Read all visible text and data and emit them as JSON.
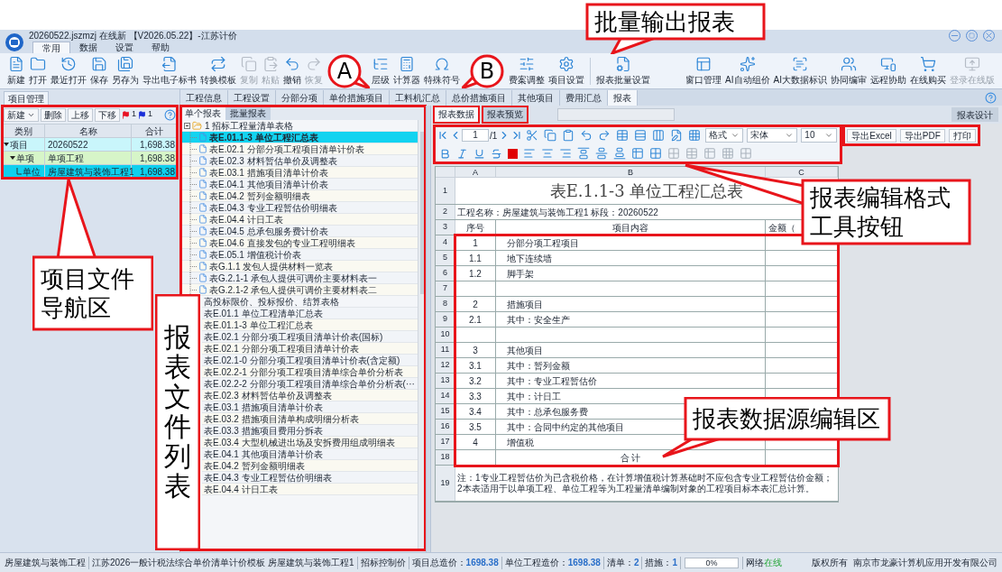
{
  "window": {
    "title": "20260522.jszmzj 在线新 【V2026.05.22】-江苏计价"
  },
  "ribbon_tabs": [
    {
      "label": "常用",
      "selected": true
    },
    {
      "label": "数据",
      "selected": false
    },
    {
      "label": "设置",
      "selected": false
    },
    {
      "label": "帮助",
      "selected": false
    }
  ],
  "toolbar": [
    {
      "label": "新建",
      "disabled": false
    },
    {
      "label": "打开",
      "disabled": false
    },
    {
      "label": "最近打开",
      "disabled": false
    },
    {
      "label": "保存",
      "disabled": false
    },
    {
      "label": "另存为",
      "disabled": false
    },
    {
      "label": "导出电子标书",
      "disabled": false
    },
    {
      "label": "转换模板",
      "disabled": false
    },
    {
      "label": "复制",
      "disabled": true
    },
    {
      "label": "粘贴",
      "disabled": true
    },
    {
      "label": "撤销",
      "disabled": false
    },
    {
      "label": "恢复",
      "disabled": true
    },
    {
      "label": "层级",
      "disabled": false
    },
    {
      "label": "计算器",
      "disabled": false
    },
    {
      "label": "特殊符号",
      "disabled": false
    },
    {
      "label": "费案调整",
      "disabled": false
    },
    {
      "label": "项目设置",
      "disabled": false
    },
    {
      "label": "报表批量设置",
      "disabled": false
    }
  ],
  "toolbar_right": [
    {
      "label": "窗口管理",
      "disabled": false
    },
    {
      "label": "AI自动组价",
      "disabled": false
    },
    {
      "label": "AI大数据标识",
      "disabled": false
    },
    {
      "label": "协同编审",
      "disabled": false
    },
    {
      "label": "远程协助",
      "disabled": false
    },
    {
      "label": "在线购买",
      "disabled": false
    },
    {
      "label": "登录在线版",
      "disabled": true
    }
  ],
  "project_panel": {
    "tab": "项目管理",
    "new_button": "新建",
    "buttons": [
      "删除",
      "上移",
      "下移"
    ],
    "flags": [
      {
        "color": "#e81123",
        "count": "1"
      },
      {
        "color": "#1a2fd8",
        "count": "1"
      }
    ],
    "columns": [
      "类别",
      "名称",
      "合计"
    ],
    "tree": [
      {
        "category": "项目",
        "name": "20260522",
        "total": "1,698.38",
        "selected": false,
        "expanded": true,
        "children": [
          {
            "category": "单项",
            "name": "单项工程",
            "total": "1,698.38",
            "selected": false,
            "expanded": true,
            "children": [
              {
                "category": "单位",
                "name": "房屋建筑与装饰工程1",
                "total": "1,698.38",
                "selected": true
              }
            ]
          }
        ]
      }
    ]
  },
  "module_tabs": [
    {
      "label": "工程信息",
      "selected": false
    },
    {
      "label": "工程设置",
      "selected": false
    },
    {
      "label": "分部分项",
      "selected": false
    },
    {
      "label": "单价措施项目",
      "selected": false
    },
    {
      "label": "工料机汇总",
      "selected": false
    },
    {
      "label": "总价措施项目",
      "selected": false
    },
    {
      "label": "其他项目",
      "selected": false
    },
    {
      "label": "费用汇总",
      "selected": false
    },
    {
      "label": "报表",
      "selected": true
    }
  ],
  "report_list": {
    "tabs": [
      {
        "label": "单个报表",
        "selected": true
      },
      {
        "label": "批量报表",
        "selected": false
      }
    ],
    "groups": [
      {
        "label": "1 招标工程量清单表格",
        "kind": "tree",
        "items": [
          {
            "label": "表E.01.1-3 单位工程汇总表",
            "selected": true
          },
          {
            "label": "表E.02.1 分部分项工程项目清单计价表",
            "selected": false
          },
          {
            "label": "表E.02.3 材料暂估单价及调整表",
            "selected": false
          },
          {
            "label": "表E.03.1 措施项目清单计价表",
            "selected": false
          },
          {
            "label": "表E.04.1 其他项目清单计价表",
            "selected": false
          },
          {
            "label": "表E.04.2 暂列金额明细表",
            "selected": false
          },
          {
            "label": "表E.04.3 专业工程暂估价明细表",
            "selected": false
          },
          {
            "label": "表E.04.4 计日工表",
            "selected": false
          },
          {
            "label": "表E.04.5 总承包服务费计价表",
            "selected": false
          },
          {
            "label": "表E.04.6 直接发包的专业工程明细表",
            "selected": false
          },
          {
            "label": "表E.05.1 增值税计价表",
            "selected": false
          },
          {
            "label": "表G.1.1 发包人提供材料一览表",
            "selected": false
          },
          {
            "label": "表G.2.1-1 承包人提供可调价主要材料表一",
            "selected": false
          },
          {
            "label": "表G.2.1-2 承包人提供可调价主要材料表二",
            "selected": false
          }
        ]
      },
      {
        "label": "高投标限价、投标报价、结算表格",
        "kind": "plain",
        "items": [
          {
            "label": "表E.01.1 单位工程清单汇总表",
            "selected": false
          },
          {
            "label": "表E.01.1-3 单位工程汇总表",
            "selected": false
          },
          {
            "label": "表E.02.1 分部分项工程项目清单计价表(国标)",
            "selected": false
          },
          {
            "label": "表E.02.1 分部分项工程项目清单计价表",
            "selected": false
          },
          {
            "label": "表E.02.1-0 分部分项工程项目清单计价表(含定额)",
            "selected": false
          },
          {
            "label": "表E.02.2-1 分部分项工程项目清单综合单价分析表",
            "selected": false
          },
          {
            "label": "表E.02.2-2 分部分项工程项目清单综合单价分析表(···",
            "selected": false
          },
          {
            "label": "表E.02.3 材料暂估单价及调整表",
            "selected": false
          },
          {
            "label": "表E.03.1 措施项目清单计价表",
            "selected": false
          },
          {
            "label": "表E.03.2 措施项目清单构成明细分析表",
            "selected": false
          },
          {
            "label": "表E.03.3 措施项目费用分拆表",
            "selected": false
          },
          {
            "label": "表E.03.4 大型机械进出场及安拆费用组成明细表",
            "selected": false
          },
          {
            "label": "表E.04.1 其他项目清单计价表",
            "selected": false
          },
          {
            "label": "表E.04.2 暂列金额明细表",
            "selected": false
          },
          {
            "label": "表E.04.3 专业工程暂估价明细表",
            "selected": false
          },
          {
            "label": "表E.04.4 计日工表",
            "selected": false
          }
        ]
      }
    ]
  },
  "report_tabs": [
    {
      "label": "报表数据",
      "selected": true
    },
    {
      "label": "报表预览",
      "selected": false
    }
  ],
  "design_button": "报表设计",
  "format_toolbar": {
    "page": "1",
    "page_total": "/1",
    "style_select": "格式",
    "font_select": "宋体",
    "size_select": "10",
    "export_buttons": [
      "导出Excel",
      "导出PDF",
      "打印"
    ]
  },
  "sheet": {
    "columns": [
      "A",
      "B",
      "C"
    ],
    "rows": [
      {
        "number": "1",
        "kind": "title",
        "text": "表E.1.1-3 单位工程汇总表"
      },
      {
        "number": "2",
        "kind": "info",
        "text": "工程名称：房屋建筑与装饰工程1   标段：20260522"
      },
      {
        "number": "3",
        "kind": "header",
        "cells": [
          "序号",
          "项目内容",
          "金额（"
        ]
      },
      {
        "number": "4",
        "kind": "item",
        "cells": [
          "1",
          "分部分项工程项目"
        ]
      },
      {
        "number": "5",
        "kind": "item",
        "cells": [
          "1.1",
          "地下连续墙"
        ]
      },
      {
        "number": "6",
        "kind": "item",
        "cells": [
          "1.2",
          "脚手架"
        ]
      },
      {
        "number": "7",
        "kind": "blank"
      },
      {
        "number": "8",
        "kind": "item",
        "cells": [
          "2",
          "措施项目"
        ]
      },
      {
        "number": "9",
        "kind": "item",
        "cells": [
          "2.1",
          "其中：安全生产"
        ]
      },
      {
        "number": "10",
        "kind": "blank"
      },
      {
        "number": "11",
        "kind": "item",
        "cells": [
          "3",
          "其他项目"
        ]
      },
      {
        "number": "12",
        "kind": "item",
        "cells": [
          "3.1",
          "其中：暂列金额"
        ]
      },
      {
        "number": "13",
        "kind": "item",
        "cells": [
          "3.2",
          "其中：专业工程暂估价"
        ]
      },
      {
        "number": "14",
        "kind": "item",
        "cells": [
          "3.3",
          "其中：计日工"
        ]
      },
      {
        "number": "15",
        "kind": "item",
        "cells": [
          "3.4",
          "其中：总承包服务费"
        ]
      },
      {
        "number": "16",
        "kind": "item",
        "cells": [
          "3.5",
          "其中：合同中约定的其他项目"
        ]
      },
      {
        "number": "17",
        "kind": "item",
        "cells": [
          "4",
          "增值税"
        ]
      },
      {
        "number": "18",
        "kind": "total",
        "text": "合 计"
      },
      {
        "number": "19",
        "kind": "note",
        "text": "注：1专业工程暂估价为已含税价格，在计算增值税计算基础时不应包含专业工程暂估价金额；2本表适用于以单项工程、单位工程等为工程量清单编制对象的工程项目标本表汇总计算。"
      }
    ]
  },
  "status_bar": {
    "segments": [
      {
        "text": "房屋建筑与装饰工程"
      },
      {
        "text": "江苏2026一般计税法综合单价清单计价模板 房屋建筑与装饰工程1"
      },
      {
        "text": "招标控制价"
      },
      {
        "label": "项目总造价：",
        "value": "1698.38"
      },
      {
        "label": "单位工程造价：",
        "value": "1698.38"
      },
      {
        "label": "清单：",
        "value": "2"
      },
      {
        "label": "措施：",
        "value": "1"
      }
    ],
    "progress": {
      "level": 0,
      "text": "0%"
    },
    "network": {
      "label": "网络",
      "value": "在线"
    },
    "copyright": "版权所有",
    "company": "南京市龙豪计算机应用开发有限公司"
  },
  "callouts": [
    {
      "kind": "box",
      "text": "批量输出报表"
    },
    {
      "kind": "circle",
      "text": "A"
    },
    {
      "kind": "circle",
      "text": "B"
    },
    {
      "kind": "box",
      "text": "项目文件导航区"
    },
    {
      "kind": "vertical",
      "text": "报表文件列表"
    },
    {
      "kind": "box",
      "text": "报表编辑格式工具按钮"
    },
    {
      "kind": "box",
      "text": "报表数据源编辑区"
    }
  ]
}
